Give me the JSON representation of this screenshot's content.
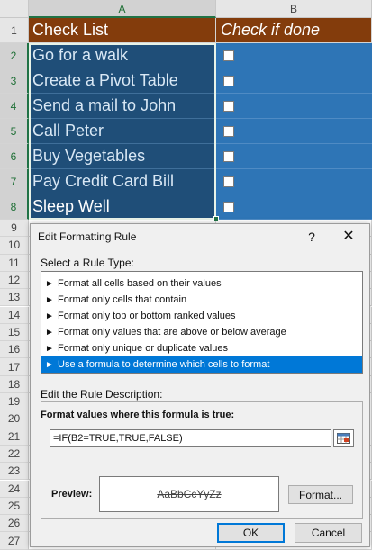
{
  "columns": [
    "A",
    "B"
  ],
  "rows": [
    "1",
    "2",
    "3",
    "4",
    "5",
    "6",
    "7",
    "8",
    "9",
    "10",
    "11",
    "12",
    "13",
    "14",
    "15",
    "16",
    "17",
    "18",
    "19",
    "20",
    "21",
    "22",
    "23",
    "24",
    "25",
    "26",
    "27"
  ],
  "sheet": {
    "header_a": "Check List",
    "header_b": "Check if done",
    "tasks": [
      "Go for a walk",
      "Create a Pivot Table",
      "Send a mail to John",
      "Call Peter",
      "Buy Vegetables",
      "Pay Credit Card Bill",
      "Sleep Well"
    ]
  },
  "colors": {
    "header_fill": "#833c0c",
    "task_fill": "#1f4e78",
    "check_fill": "#2e75b6",
    "selection_blue": "#0078d7",
    "excel_green": "#217346"
  },
  "dialog": {
    "title": "Edit Formatting Rule",
    "help_glyph": "?",
    "close_glyph": "✕",
    "rule_type_label": "Select a Rule Type:",
    "rule_types": [
      "Format all cells based on their values",
      "Format only cells that contain",
      "Format only top or bottom ranked values",
      "Format only values that are above or below average",
      "Format only unique or duplicate values",
      "Use a formula to determine which cells to format"
    ],
    "selected_rule_index": 5,
    "description_label": "Edit the Rule Description:",
    "formula_label": "Format values where this formula is true:",
    "formula_value": "=IF(B2=TRUE,TRUE,FALSE)",
    "preview_label": "Preview:",
    "preview_text": "AaBbCcYyZz",
    "format_button": "Format...",
    "ok_button": "OK",
    "cancel_button": "Cancel"
  },
  "icons": {
    "rule_arrow": "arrow-icon",
    "collapse_dialog": "range-selector-icon"
  }
}
